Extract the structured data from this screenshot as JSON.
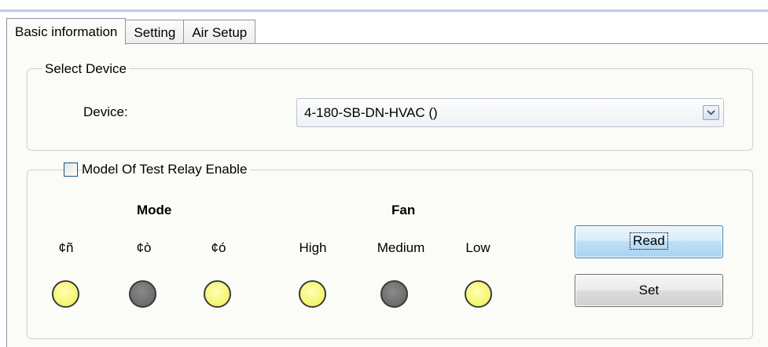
{
  "tabs": [
    {
      "label": "Basic information",
      "active": true
    },
    {
      "label": "Setting",
      "active": false
    },
    {
      "label": "Air Setup",
      "active": false
    }
  ],
  "select_device": {
    "group_title": "Select Device",
    "device_label": "Device:",
    "device_value": "4-180-SB-DN-HVAC ()",
    "dropdown_icon": "chevron-down-icon"
  },
  "relay_test": {
    "enable_label": "Model Of Test Relay Enable",
    "enabled": false,
    "mode_heading": "Mode",
    "fan_heading": "Fan",
    "indicators": [
      {
        "label": "¢ñ",
        "state": "on"
      },
      {
        "label": "¢ò",
        "state": "off"
      },
      {
        "label": "¢ó",
        "state": "on"
      },
      {
        "label": "High",
        "state": "on"
      },
      {
        "label": "Medium",
        "state": "off"
      },
      {
        "label": "Low",
        "state": "on"
      }
    ],
    "read_label": "Read",
    "set_label": "Set"
  },
  "colors": {
    "led_on": "#f4f46a",
    "led_off": "#6c6c6c",
    "panel_bg": "#fbfbf8"
  }
}
